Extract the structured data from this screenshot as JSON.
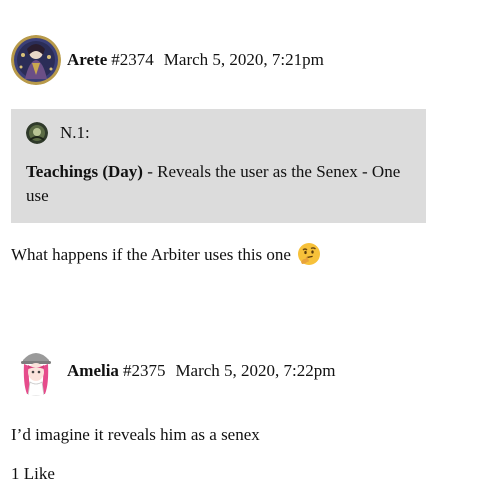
{
  "posts": [
    {
      "username": "Arete",
      "number": "#2374",
      "date": "March 5, 2020, 7:21pm",
      "quote": {
        "author": "N.1:",
        "title": "Teachings (Day)",
        "text": " - Reveals the user as the Senex - One use"
      },
      "body": "What happens if the Arbiter uses this one",
      "emoji": "thinking-face"
    },
    {
      "username": "Amelia",
      "number": "#2375",
      "date": "March 5, 2020, 7:22pm",
      "body": "I’d imagine it reveals him as a senex",
      "likes": "1 Like"
    }
  ]
}
